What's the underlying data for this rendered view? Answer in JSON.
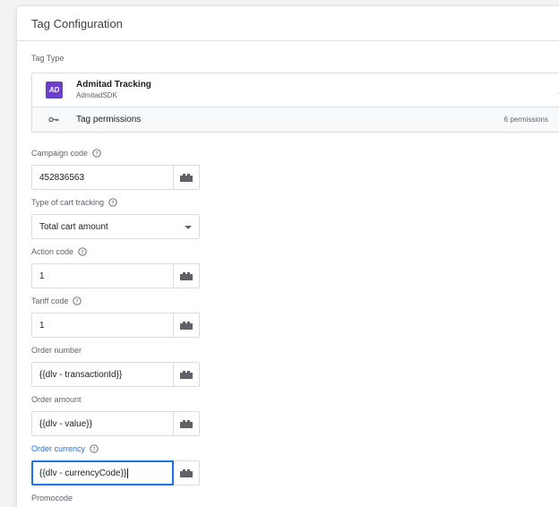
{
  "card": {
    "title": "Tag Configuration"
  },
  "tag_type": {
    "section_label": "Tag Type",
    "logo_text": "AD",
    "name": "Admitad Tracking",
    "subtitle": "AdmitadSDK",
    "permissions_label": "Tag permissions",
    "permissions_count": "6 permissions"
  },
  "fields": [
    {
      "label": "Campaign code",
      "value": "452836563",
      "help": true
    },
    {
      "label": "Type of cart tracking",
      "value": "Total cart amount",
      "help": true,
      "type": "select"
    },
    {
      "label": "Action code",
      "value": "1",
      "help": true
    },
    {
      "label": "Tariff code",
      "value": "1",
      "help": true
    },
    {
      "label": "Order number",
      "value": "{{dlv - transactionId}}",
      "help": false
    },
    {
      "label": "Order amount",
      "value": "{{dlv - value}}",
      "help": false
    },
    {
      "label": "Order currency",
      "value": "{{dlv - currencyCode}}",
      "help": true,
      "focused": true
    },
    {
      "label": "Promocode",
      "value": ""
    }
  ],
  "colors": {
    "accent": "#1a73e8",
    "logo": "#6b3fc9"
  }
}
